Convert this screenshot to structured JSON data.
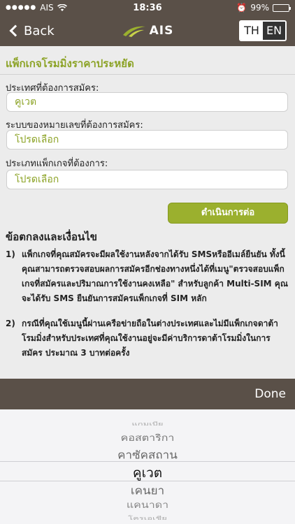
{
  "status_bar": {
    "carrier": "AIS",
    "time": "18:36",
    "battery": "99%",
    "battery_level": 0.99
  },
  "nav": {
    "back_label": "Back",
    "logo_text": "AIS",
    "lang_th": "TH",
    "lang_en": "EN"
  },
  "form": {
    "section_title": "แพ็กเกจโรมมิ่งราคาประหยัด",
    "country_label": "ประเทศที่ต้องการสมัคร:",
    "country_value": "คูเวต",
    "network_label": "ระบบของหมายเลขที่ต้องการสมัคร:",
    "network_value": "โปรดเลือก",
    "package_label": "ประเภทแพ็กเกจที่ต้องการ:",
    "package_value": "โปรดเลือก",
    "proceed_label": "ดำเนินการต่อ"
  },
  "terms": {
    "title": "ข้อตกลงและเงื่อนไข",
    "items": [
      {
        "num": "1)",
        "text": "แพ็กเกจที่คุณสมัครจะมีผลใช้งานหลังจากได้รับ SMSหรืออีเมล์ยืนยัน ทั้งนี้คุณสามารถตรวจสอบผลการสมัครอีกช่องทางหนึ่งได้ที่เมนู\"ตรวจสอบแพ็กเกจที่สมัครและปริมาณการใช้งานคงเหลือ\" สำหรับลูกค้า Multi-SIM คุณจะได้รับ SMS ยืนยันการสมัครแพ็กเกจที่ SIM หลัก"
      },
      {
        "num": "2)",
        "text": "กรณีที่คุณใช้เมนูนี้ผ่านเครือข่ายถือในต่างประเทศและไม่มีแพ็กเกจดาต้าโรมมิ่งสำหรับประเทศที่คุณใช้งานอยู่จะมีค่าบริการดาต้าโรมมิ่งในการสมัคร ประมาณ 3 บาทต่อครั้ง"
      }
    ]
  },
  "toolbar": {
    "done_label": "Done"
  },
  "picker": {
    "items": [
      "แกมเบีย",
      "คอสตาริกา",
      "คาซัคสถาน",
      "คูเวต",
      "เคนยา",
      "แคนาดา",
      "โครเอเชีย"
    ],
    "selected": "คูเวต"
  }
}
